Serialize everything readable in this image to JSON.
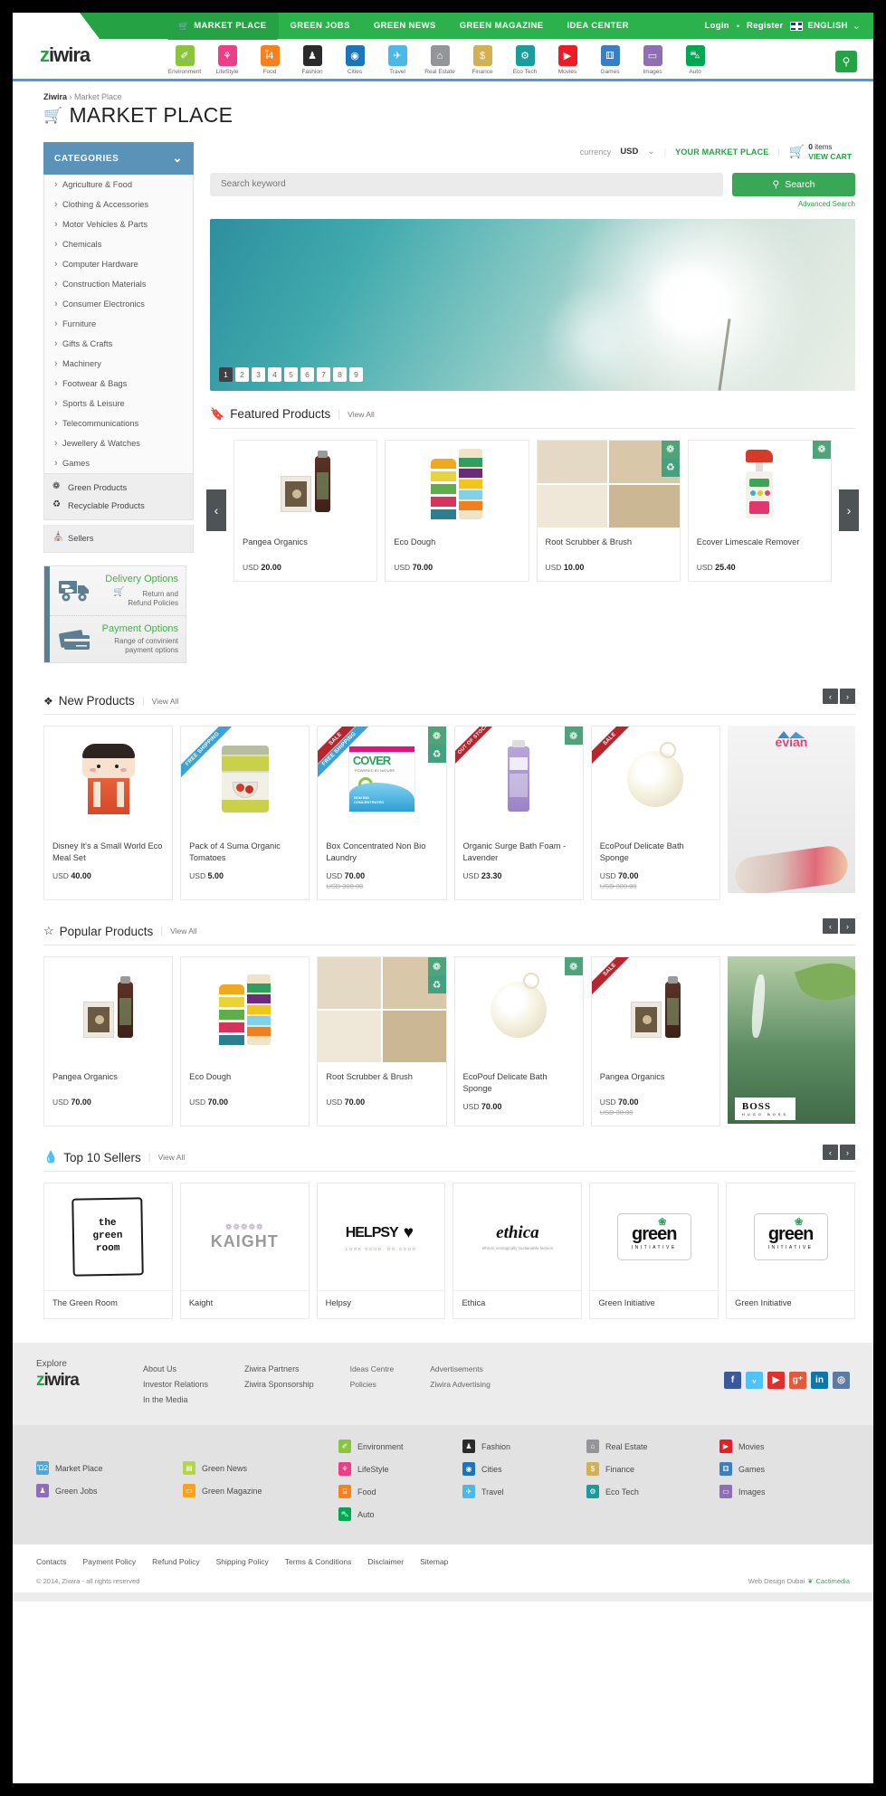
{
  "header": {
    "logo": {
      "prefix": "z",
      "rest": "iwira"
    },
    "topnav": [
      {
        "label": "MARKET PLACE",
        "icon": "cart-icon",
        "active": true
      },
      {
        "label": "GREEN JOBS",
        "active": false
      },
      {
        "label": "GREEN NEWS",
        "active": false
      },
      {
        "label": "GREEN MAGAZINE",
        "active": false
      },
      {
        "label": "IDEA CENTER",
        "active": false
      }
    ],
    "login": "Login",
    "dot": "•",
    "register": "Register",
    "language": "ENGLISH",
    "lang_caret": "⌄",
    "search_icon": "search-icon",
    "categories": [
      {
        "label": "Environment",
        "color": "#8bc53f",
        "glyph": "✐"
      },
      {
        "label": "LifeStyle",
        "color": "#ec3f87",
        "glyph": "⚘"
      },
      {
        "label": "Food",
        "color": "#f5821f",
        "glyph": "ἷ4"
      },
      {
        "label": "Fashion",
        "color": "#2b2b2b",
        "glyph": "♟"
      },
      {
        "label": "Cities",
        "color": "#1b75bb",
        "glyph": "◉"
      },
      {
        "label": "Travel",
        "color": "#4bb8e8",
        "glyph": "✈"
      },
      {
        "label": "Real Estate",
        "color": "#939598",
        "glyph": "⌂"
      },
      {
        "label": "Finance",
        "color": "#d4b055",
        "glyph": "$"
      },
      {
        "label": "Eco Tech",
        "color": "#1a9c9c",
        "glyph": "⚙"
      },
      {
        "label": "Movies",
        "color": "#ed1c24",
        "glyph": "▶"
      },
      {
        "label": "Games",
        "color": "#3a7fc1",
        "glyph": "⚅"
      },
      {
        "label": "Images",
        "color": "#8e6eb5",
        "glyph": "▭"
      },
      {
        "label": "Auto",
        "color": "#00a651",
        "glyph": "⛍"
      }
    ]
  },
  "breadcrumb": {
    "root": "Ziwira",
    "sep": "›",
    "current": "Market Place"
  },
  "page_title": "MARKET PLACE",
  "page_title_icon": "cart-icon",
  "sidebar": {
    "categories_header": "CATEGORIES",
    "caret": "⌄",
    "categories": [
      "Agriculture & Food",
      "Clothing & Accessories",
      "Motor Vehicles & Parts",
      "Chemicals",
      "Computer Hardware",
      "Construction Materials",
      "Consumer Electronics",
      "Furniture",
      "Gifts & Crafts",
      "Machinery",
      "Footwear & Bags",
      "Sports & Leisure",
      "Telecommunications",
      "Jewellery & Watches",
      "Games"
    ],
    "green_items": [
      {
        "label": "Green Products",
        "icon": "leaf-icon",
        "glyph": "❁"
      },
      {
        "label": "Recyclable Products",
        "icon": "recycle-icon",
        "glyph": "♻"
      }
    ],
    "sellers": {
      "label": "Sellers",
      "icon": "store-icon",
      "glyph": "⛪"
    },
    "promo": {
      "delivery_title": "Delivery Options",
      "delivery_sub_line1": "Return and",
      "delivery_sub_line2": "Refund Policies",
      "delivery_icon": "truck-icon",
      "delivery_sub_icon": "cart-icon",
      "payment_title": "Payment Options",
      "payment_sub_line1": "Range of convinient",
      "payment_sub_line2": "payment options",
      "payment_icon": "credit-card-icon"
    }
  },
  "search": {
    "currency_label": "currency",
    "currency_value": "USD",
    "currency_caret": "⌄",
    "your_market_place": "YOUR MARKET PLACE",
    "cart_count": "0",
    "cart_items_label": "items",
    "view_cart": "VIEW CART",
    "placeholder": "Search keyword",
    "value": "",
    "button": "Search",
    "button_icon": "search-icon",
    "advanced": "Advanced Search"
  },
  "banner": {
    "pages": [
      "1",
      "2",
      "3",
      "4",
      "5",
      "6",
      "7",
      "8",
      "9"
    ],
    "active_page": "1"
  },
  "sections": {
    "featured": {
      "title": "Featured Products",
      "icon": "bookmark-icon",
      "view_all": "View All",
      "sep": "|",
      "products": [
        {
          "name": "Pangea Organics",
          "currency": "USD",
          "price": "20.00",
          "old_price": "",
          "badges": [],
          "corner": "",
          "img": "pangea-organics"
        },
        {
          "name": "Eco Dough",
          "currency": "USD",
          "price": "70.00",
          "old_price": "",
          "badges": [],
          "corner": "",
          "img": "eco-dough"
        },
        {
          "name": "Root Scrubber & Brush",
          "currency": "USD",
          "price": "10.00",
          "old_price": "",
          "badges": [
            "green",
            "recycle"
          ],
          "corner": "",
          "img": "root-scrubber"
        },
        {
          "name": "Ecover Limescale Remover",
          "currency": "USD",
          "price": "25.40",
          "old_price": "",
          "badges": [
            "green"
          ],
          "corner": "",
          "img": "ecover-spray"
        }
      ]
    },
    "new": {
      "title": "New Products",
      "icon": "grid-icon",
      "view_all": "View All",
      "sep": "|",
      "prev": "‹",
      "next": "›",
      "products": [
        {
          "name": "Disney It's a Small World Eco Meal Set",
          "currency": "USD",
          "price": "40.00",
          "old_price": "",
          "badges": [],
          "corner": "",
          "img": "disney-meal-set"
        },
        {
          "name": "Pack of 4 Suma Organic Tomatoes",
          "currency": "USD",
          "price": "5.00",
          "old_price": "",
          "badges": [],
          "corner": "FREE SHIPPING",
          "corner_type": "free",
          "img": "suma-tomatoes"
        },
        {
          "name": "Box Concentrated Non Bio Laundry",
          "currency": "USD",
          "price": "70.00",
          "old_price": "USD 300.00",
          "badges": [
            "green",
            "recycle"
          ],
          "corner": "SALE",
          "corner_type": "sale",
          "corner2": "FREE SHIPPING",
          "img": "ecover-box"
        },
        {
          "name": "Organic Surge Bath Foam - Lavender",
          "currency": "USD",
          "price": "23.30",
          "old_price": "",
          "badges": [
            "green"
          ],
          "corner": "OUT OF STOCK",
          "corner_type": "oos",
          "img": "organic-surge"
        },
        {
          "name": "EcoPouf Delicate Bath Sponge",
          "currency": "USD",
          "price": "70.00",
          "old_price": "USD 300.00",
          "badges": [],
          "corner": "SALE",
          "corner_type": "sale",
          "img": "ecopouf"
        },
        {
          "name": "",
          "currency": "",
          "price": "",
          "old_price": "",
          "badges": [],
          "corner": "",
          "img": "evian-ad"
        }
      ]
    },
    "popular": {
      "title": "Popular Products",
      "icon": "star-icon",
      "view_all": "View All",
      "sep": "|",
      "prev": "‹",
      "next": "›",
      "products": [
        {
          "name": "Pangea Organics",
          "currency": "USD",
          "price": "70.00",
          "old_price": "",
          "badges": [],
          "corner": "",
          "img": "pangea-organics"
        },
        {
          "name": "Eco Dough",
          "currency": "USD",
          "price": "70.00",
          "old_price": "",
          "badges": [],
          "corner": "",
          "img": "eco-dough"
        },
        {
          "name": "Root Scrubber & Brush",
          "currency": "USD",
          "price": "70.00",
          "old_price": "",
          "badges": [
            "green",
            "recycle"
          ],
          "corner": "",
          "img": "root-scrubber"
        },
        {
          "name": "EcoPouf Delicate Bath Sponge",
          "currency": "USD",
          "price": "70.00",
          "old_price": "",
          "badges": [
            "green"
          ],
          "corner": "",
          "img": "ecopouf"
        },
        {
          "name": "Pangea Organics",
          "currency": "USD",
          "price": "70.00",
          "old_price": "USD 30.00",
          "badges": [],
          "corner": "SALE",
          "corner_type": "sale",
          "img": "pangea-organics"
        },
        {
          "name": "",
          "currency": "",
          "price": "",
          "old_price": "",
          "badges": [],
          "corner": "",
          "img": "boss-ad"
        }
      ]
    },
    "sellers": {
      "title": "Top 10 Sellers",
      "icon": "flame-icon",
      "view_all": "View All",
      "sep": "|",
      "prev": "‹",
      "next": "›",
      "items": [
        {
          "name": "The Green Room",
          "logo": "the-green-room"
        },
        {
          "name": "Kaight",
          "logo": "kaight"
        },
        {
          "name": "Helpsy",
          "logo": "helpsy"
        },
        {
          "name": "Ethica",
          "logo": "ethica"
        },
        {
          "name": "Green Initiative",
          "logo": "green-initiative"
        },
        {
          "name": "Green Initiative",
          "logo": "green-initiative"
        }
      ]
    }
  },
  "footer": {
    "explore_label": "Explore",
    "logo_prefix": "z",
    "logo_rest": "iwira",
    "col1": [
      "About Us",
      "Investor Relations",
      "In the Media"
    ],
    "col2": [
      "Ziwira Partners",
      "Ziwira Sponsorship"
    ],
    "col3": [
      "Ideas Centre",
      "Policies"
    ],
    "col4": [
      "Advertisements",
      "Ziwira Advertising"
    ],
    "socials": [
      {
        "name": "facebook-icon",
        "glyph": "f",
        "color": "#3b5998"
      },
      {
        "name": "twitter-icon",
        "glyph": "ᵥ",
        "color": "#4fc3f7"
      },
      {
        "name": "youtube-icon",
        "glyph": "▶",
        "color": "#e02f2f"
      },
      {
        "name": "google-plus-icon",
        "glyph": "g⁺",
        "color": "#e5593b"
      },
      {
        "name": "linkedin-icon",
        "glyph": "in",
        "color": "#0e76a8"
      },
      {
        "name": "instagram-icon",
        "glyph": "◎",
        "color": "#5b7ca0"
      }
    ],
    "portals": {
      "c1": [
        {
          "label": "Market Place",
          "color": "#4fa8d8",
          "glyph": "Ὥ2"
        },
        {
          "label": "Green Jobs",
          "color": "#8e6eb5",
          "glyph": "♟"
        }
      ],
      "c2": [
        {
          "label": "Green News",
          "color": "#b4d44a",
          "glyph": "▤"
        },
        {
          "label": "Green Magazine",
          "color": "#f5a31f",
          "glyph": "▭"
        }
      ],
      "c3": [
        {
          "label": "Environment",
          "color": "#8bc53f",
          "glyph": "✐"
        },
        {
          "label": "LifeStyle",
          "color": "#ec3f87",
          "glyph": "⚘"
        },
        {
          "label": "Food",
          "color": "#f5821f",
          "glyph": "⌸"
        },
        {
          "label": "Auto",
          "color": "#00a651",
          "glyph": "⛍"
        }
      ],
      "c4": [
        {
          "label": "Fashion",
          "color": "#2b2b2b",
          "glyph": "♟"
        },
        {
          "label": "Cities",
          "color": "#1b75bb",
          "glyph": "◉"
        },
        {
          "label": "Travel",
          "color": "#4bb8e8",
          "glyph": "✈"
        }
      ],
      "c5": [
        {
          "label": "Real Estate",
          "color": "#939598",
          "glyph": "⌂"
        },
        {
          "label": "Finance",
          "color": "#d4b055",
          "glyph": "$"
        },
        {
          "label": "Eco Tech",
          "color": "#1a9c9c",
          "glyph": "⚙"
        }
      ],
      "c6": [
        {
          "label": "Movies",
          "color": "#ed1c24",
          "glyph": "▶"
        },
        {
          "label": "Games",
          "color": "#3a7fc1",
          "glyph": "⚅"
        },
        {
          "label": "Images",
          "color": "#8e6eb5",
          "glyph": "▭"
        }
      ]
    },
    "links": [
      "Contacts",
      "Payment Policy",
      "Refund Policy",
      "Shipping Policy",
      "Terms & Conditions",
      "Disclaimer",
      "Sitemap"
    ],
    "copyright": "© 2014, Ziwira - all rights reserved",
    "credit_text": "Web Design Dubai",
    "credit_brand": "Cactimedia"
  },
  "colors": {
    "green": "#25a244",
    "green_light": "#2bb24c",
    "blue": "#5b93b8",
    "dark": "#4e5356",
    "sale_red": "#b5262e",
    "free_blue": "#3ba2d4",
    "badge_green": "#4fa37a"
  }
}
